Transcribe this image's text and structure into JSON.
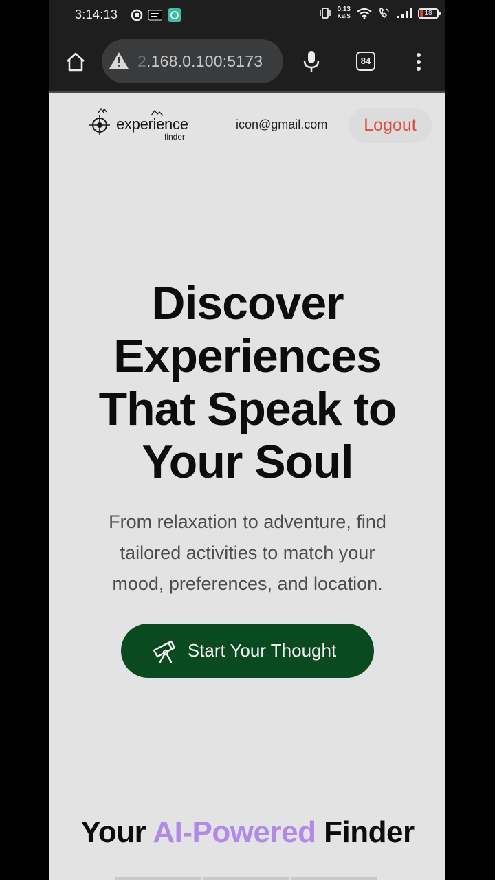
{
  "status_bar": {
    "time": "3:14:13",
    "net_speed_value": "0.13",
    "net_speed_unit": "KB/S",
    "battery_level": "18"
  },
  "browser": {
    "url_visible_prefix": "2",
    "url_text": ".168.0.100:5173",
    "tab_count": "84"
  },
  "navbar": {
    "logo_word": "experience",
    "logo_sub": "finder",
    "user_email": "icon@gmail.com",
    "logout_label": "Logout"
  },
  "hero": {
    "title_line1": "Discover",
    "title_line2": "Experiences",
    "title_line3": "That Speak to",
    "title_line4": "Your Soul",
    "subtitle_line1": "From relaxation to adventure, find",
    "subtitle_line2": "tailored activities to match your",
    "subtitle_line3": "mood, preferences, and location.",
    "cta_label": "Start Your Thought"
  },
  "section": {
    "title_part1": "Your ",
    "title_accent": "AI-Powered",
    "title_part2": " Finder"
  },
  "colors": {
    "cta_bg": "#0a4a20",
    "accent": "#b189e8",
    "logout_text": "#e04a3f"
  }
}
